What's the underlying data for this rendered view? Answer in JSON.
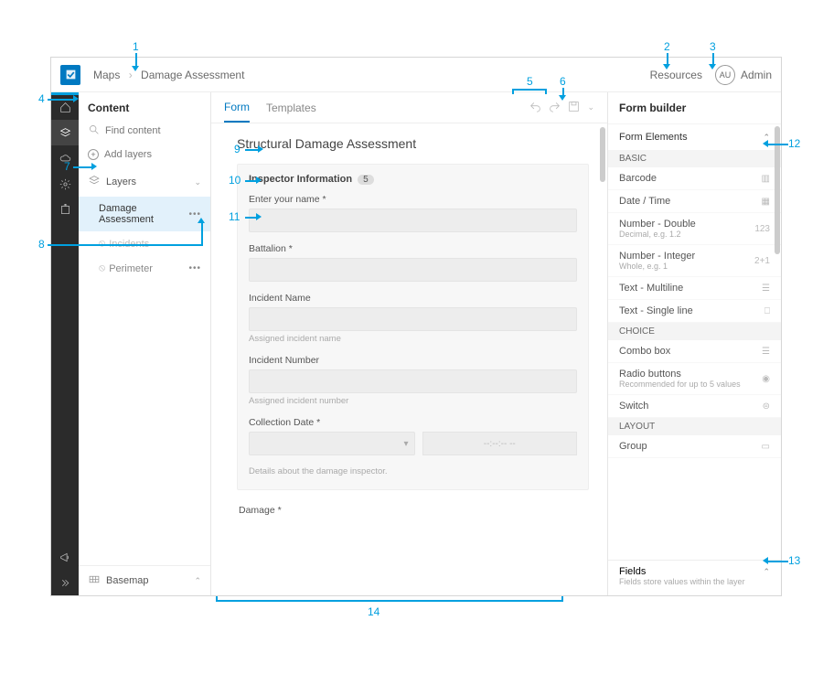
{
  "topbar": {
    "breadcrumb_root": "Maps",
    "breadcrumb_leaf": "Damage Assessment",
    "resources": "Resources",
    "avatar_initials": "AU",
    "admin": "Admin"
  },
  "content": {
    "title": "Content",
    "search_placeholder": "Find content",
    "add_layers": "Add layers",
    "layers_label": "Layers",
    "layers": [
      {
        "name": "Damage Assessment",
        "active": true
      },
      {
        "name": "Incidents",
        "disabled": true
      },
      {
        "name": "Perimeter",
        "disabled": false
      }
    ],
    "basemap": "Basemap"
  },
  "center": {
    "tab_form": "Form",
    "tab_templates": "Templates",
    "form_title": "Structural Damage Assessment",
    "group_title": "Inspector Information",
    "group_count": "5",
    "fields": {
      "name_label": "Enter your name *",
      "battalion_label": "Battalion *",
      "incident_name_label": "Incident Name",
      "incident_name_hint": "Assigned incident name",
      "incident_number_label": "Incident Number",
      "incident_number_hint": "Assigned incident number",
      "collection_date_label": "Collection Date *",
      "time_placeholder": "--:--:-- --",
      "group_desc": "Details about the damage inspector.",
      "damage_label": "Damage *"
    }
  },
  "right": {
    "title": "Form builder",
    "elements_title": "Form Elements",
    "cat_basic": "BASIC",
    "cat_choice": "CHOICE",
    "cat_layout": "LAYOUT",
    "elems": {
      "barcode": "Barcode",
      "datetime": "Date / Time",
      "num_double": "Number - Double",
      "num_double_sub": "Decimal, e.g. 1.2",
      "num_int": "Number - Integer",
      "num_int_sub": "Whole, e.g. 1",
      "text_multi": "Text - Multiline",
      "text_single": "Text - Single line",
      "combo": "Combo box",
      "radio": "Radio buttons",
      "radio_sub": "Recommended for up to 5 values",
      "switch": "Switch",
      "group": "Group"
    },
    "fields_title": "Fields",
    "fields_sub": "Fields store values within the layer"
  },
  "callouts": {
    "c1": "1",
    "c2": "2",
    "c3": "3",
    "c4": "4",
    "c5": "5",
    "c6": "6",
    "c7": "7",
    "c8": "8",
    "c9": "9",
    "c10": "10",
    "c11": "11",
    "c12": "12",
    "c13": "13",
    "c14": "14"
  }
}
